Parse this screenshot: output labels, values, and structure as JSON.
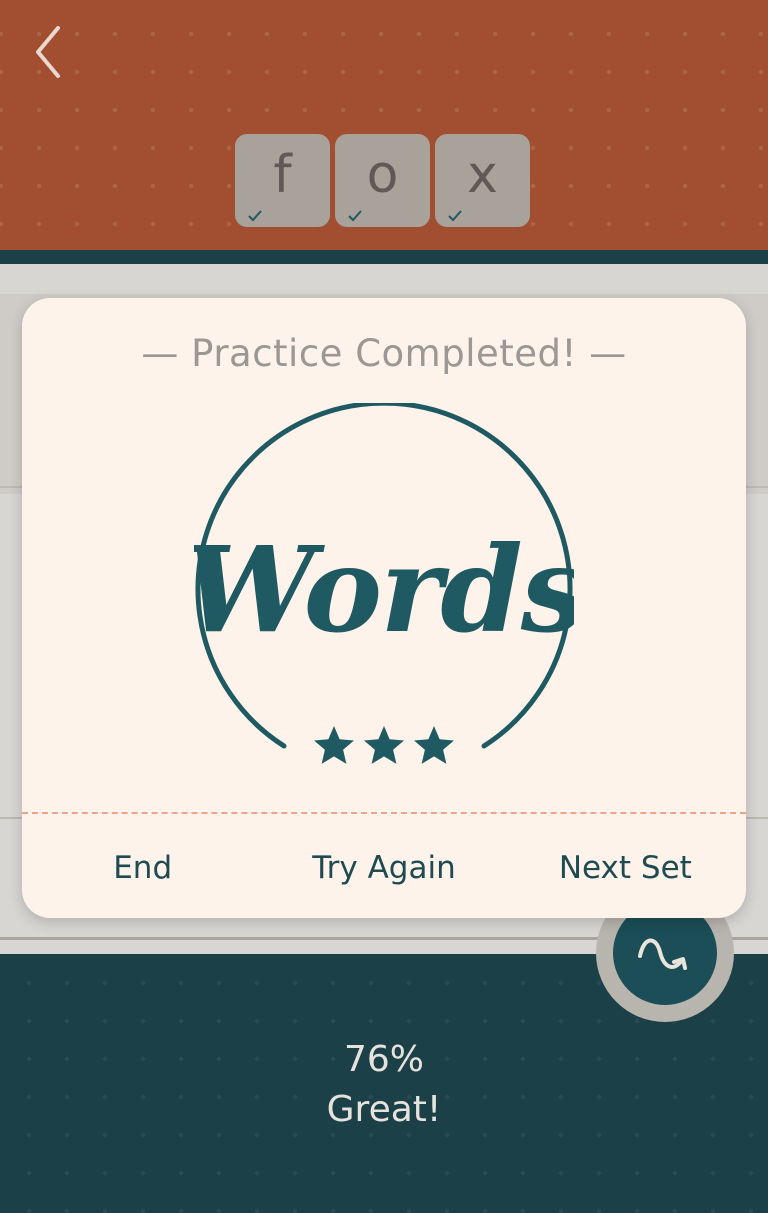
{
  "header": {
    "letters": [
      {
        "char": "f",
        "checked": true
      },
      {
        "char": "o",
        "checked": true
      },
      {
        "char": "x",
        "checked": true
      }
    ]
  },
  "modal": {
    "title": "— Practice Completed! —",
    "emblem_text": "Words",
    "stars": 3,
    "actions": {
      "end": "End",
      "try_again": "Try Again",
      "next_set": "Next Set"
    }
  },
  "score": {
    "percent": "76%",
    "rating": "Great!"
  },
  "colors": {
    "header": "#a14f30",
    "teal": "#1b4048",
    "accent_teal": "#1f5a62",
    "modal_bg": "#fdf3ea",
    "divider": "#eea48a"
  },
  "icons": {
    "back": "chevron-left-icon",
    "next": "wave-arrow-icon",
    "check": "check-icon",
    "star": "star-icon"
  }
}
